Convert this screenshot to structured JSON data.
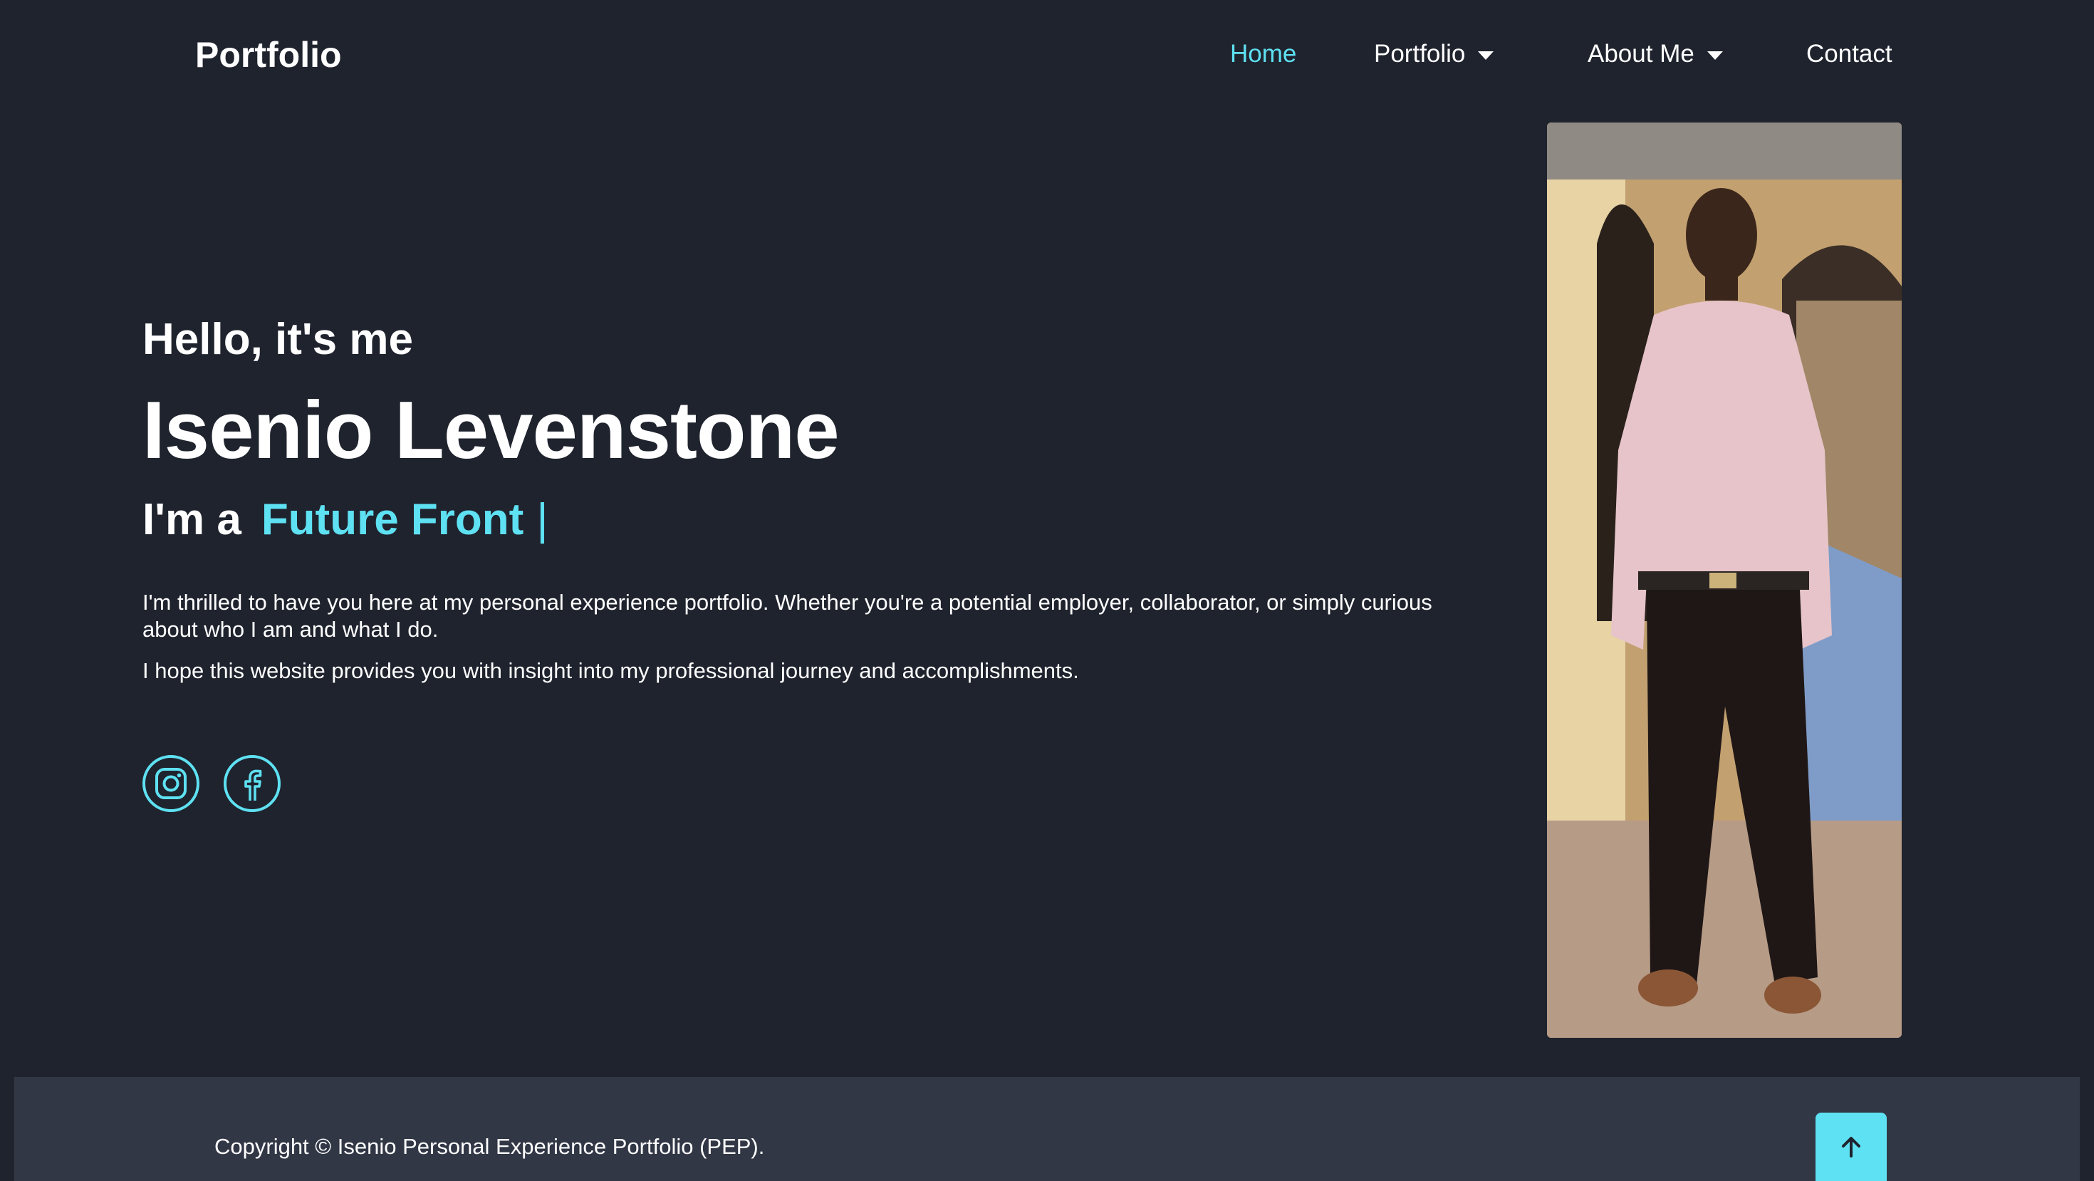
{
  "nav": {
    "logo": "Portfolio",
    "items": [
      {
        "label": "Home",
        "active": true,
        "dropdown": false
      },
      {
        "label": "Portfolio",
        "active": false,
        "dropdown": true
      },
      {
        "label": "About Me",
        "active": false,
        "dropdown": true
      },
      {
        "label": "Contact",
        "active": false,
        "dropdown": false
      }
    ]
  },
  "hero": {
    "greeting": "Hello, it's me",
    "name": "Isenio Levenstone",
    "role_prefix": "I'm a",
    "role_typed": "Future Front",
    "role_cursor": "|",
    "paragraph_1": "I'm thrilled to have you here at my personal experience portfolio. Whether you're a potential employer, collaborator, or simply curious about who I am and what I do.",
    "paragraph_2": "I hope this website provides you with insight into my professional journey and accomplishments."
  },
  "socials": [
    {
      "icon": "instagram-icon"
    },
    {
      "icon": "facebook-icon"
    }
  ],
  "photo": {
    "icon": "profile-photo"
  },
  "footer": {
    "copyright": "Copyright © Isenio Personal Experience Portfolio (PEP).",
    "to_top_icon": "arrow-up-icon"
  },
  "colors": {
    "background": "#1f232e",
    "footer": "#323746",
    "accent": "#5ee1f2",
    "text": "#ffffff"
  }
}
